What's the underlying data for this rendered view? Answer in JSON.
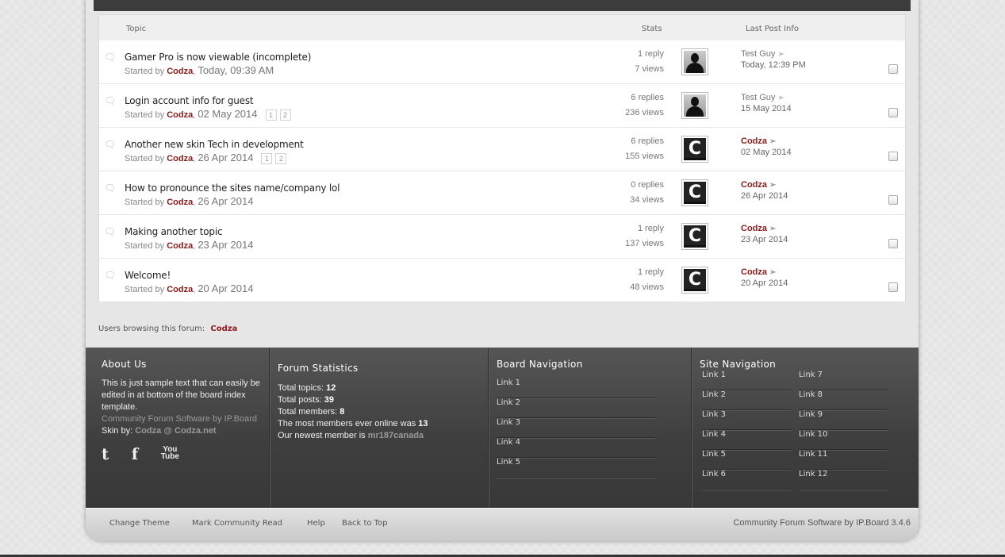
{
  "table": {
    "headers": {
      "topic": "Topic",
      "stats": "Stats",
      "last_post": "Last Post Info"
    },
    "rows": [
      {
        "title": "Gamer Pro is now viewable (incomplete)",
        "started_prefix": "Started by",
        "author": "Codza",
        "date": "Today, 09:39 AM",
        "pages": [],
        "replies": "1 reply",
        "views": "7 views",
        "avatar": "person",
        "lp_user": "Test Guy",
        "lp_user_highlight": false,
        "lp_date": "Today, 12:39 PM"
      },
      {
        "title": "Login account info for guest",
        "started_prefix": "Started by",
        "author": "Codza",
        "date": "02 May 2014",
        "pages": [
          "1",
          "2"
        ],
        "replies": "6 replies",
        "views": "236 views",
        "avatar": "person",
        "lp_user": "Test Guy",
        "lp_user_highlight": false,
        "lp_date": "15 May 2014"
      },
      {
        "title": "Another new skin Tech in development",
        "started_prefix": "Started by",
        "author": "Codza",
        "date": "26 Apr 2014",
        "pages": [
          "1",
          "2"
        ],
        "replies": "6 replies",
        "views": "155 views",
        "avatar": "C",
        "lp_user": "Codza",
        "lp_user_highlight": true,
        "lp_date": "02 May 2014"
      },
      {
        "title": "How to pronounce the sites name/company lol",
        "started_prefix": "Started by",
        "author": "Codza",
        "date": "26 Apr 2014",
        "pages": [],
        "replies": "0 replies",
        "views": "34 views",
        "avatar": "C",
        "lp_user": "Codza",
        "lp_user_highlight": true,
        "lp_date": "26 Apr 2014"
      },
      {
        "title": "Making another topic",
        "started_prefix": "Started by",
        "author": "Codza",
        "date": "23 Apr 2014",
        "pages": [],
        "replies": "1 reply",
        "views": "137 views",
        "avatar": "C",
        "lp_user": "Codza",
        "lp_user_highlight": true,
        "lp_date": "23 Apr 2014"
      },
      {
        "title": "Welcome!",
        "started_prefix": "Started by",
        "author": "Codza",
        "date": "20 Apr 2014",
        "pages": [],
        "replies": "1 reply",
        "views": "48 views",
        "avatar": "C",
        "lp_user": "Codza",
        "lp_user_highlight": true,
        "lp_date": "20 Apr 2014"
      }
    ]
  },
  "browsing": {
    "label": "Users browsing this forum:",
    "users": "Codza"
  },
  "footer": {
    "about": {
      "title": "About Us",
      "text": "This is just sample text that can easily be edited in at bottom of the board index template.",
      "software": "Community Forum Software by IP.Board",
      "skin_prefix": "Skin by:",
      "skin_credit": "Codza @ Codza.net",
      "social": {
        "twitter": "t",
        "facebook": "f",
        "youtube_line1": "You",
        "youtube_line2": "Tube"
      }
    },
    "stats": {
      "title": "Forum Statistics",
      "total_topics_label": "Total topics:",
      "total_topics": "12",
      "total_posts_label": "Total posts:",
      "total_posts": "39",
      "total_members_label": "Total members:",
      "total_members": "8",
      "most_online_label": "The most members ever online was",
      "most_online": "13",
      "newest_label": "Our newest member is",
      "newest": "mr187canada"
    },
    "board_nav": {
      "title": "Board Navigation",
      "links": [
        "Link 1",
        "Link 2",
        "Link 3",
        "Link 4",
        "Link 5"
      ]
    },
    "site_nav": {
      "title": "Site Navigation",
      "col1": [
        "Link 1",
        "Link 2",
        "Link 3",
        "Link 4",
        "Link 5",
        "Link 6"
      ],
      "col2": [
        "Link 7",
        "Link 8",
        "Link 9",
        "Link 10",
        "Link 11",
        "Link 12"
      ]
    }
  },
  "bottom_bar": {
    "links": [
      "Change Theme",
      "Mark Community Read",
      "Help",
      "Back to Top"
    ],
    "copyright": "Community Forum Software by IP.Board 3.4.6"
  },
  "colors": {
    "accent": "#8b1a1a",
    "footer_bg": "#3e3e3e",
    "topbar": "#3c3c3c"
  }
}
